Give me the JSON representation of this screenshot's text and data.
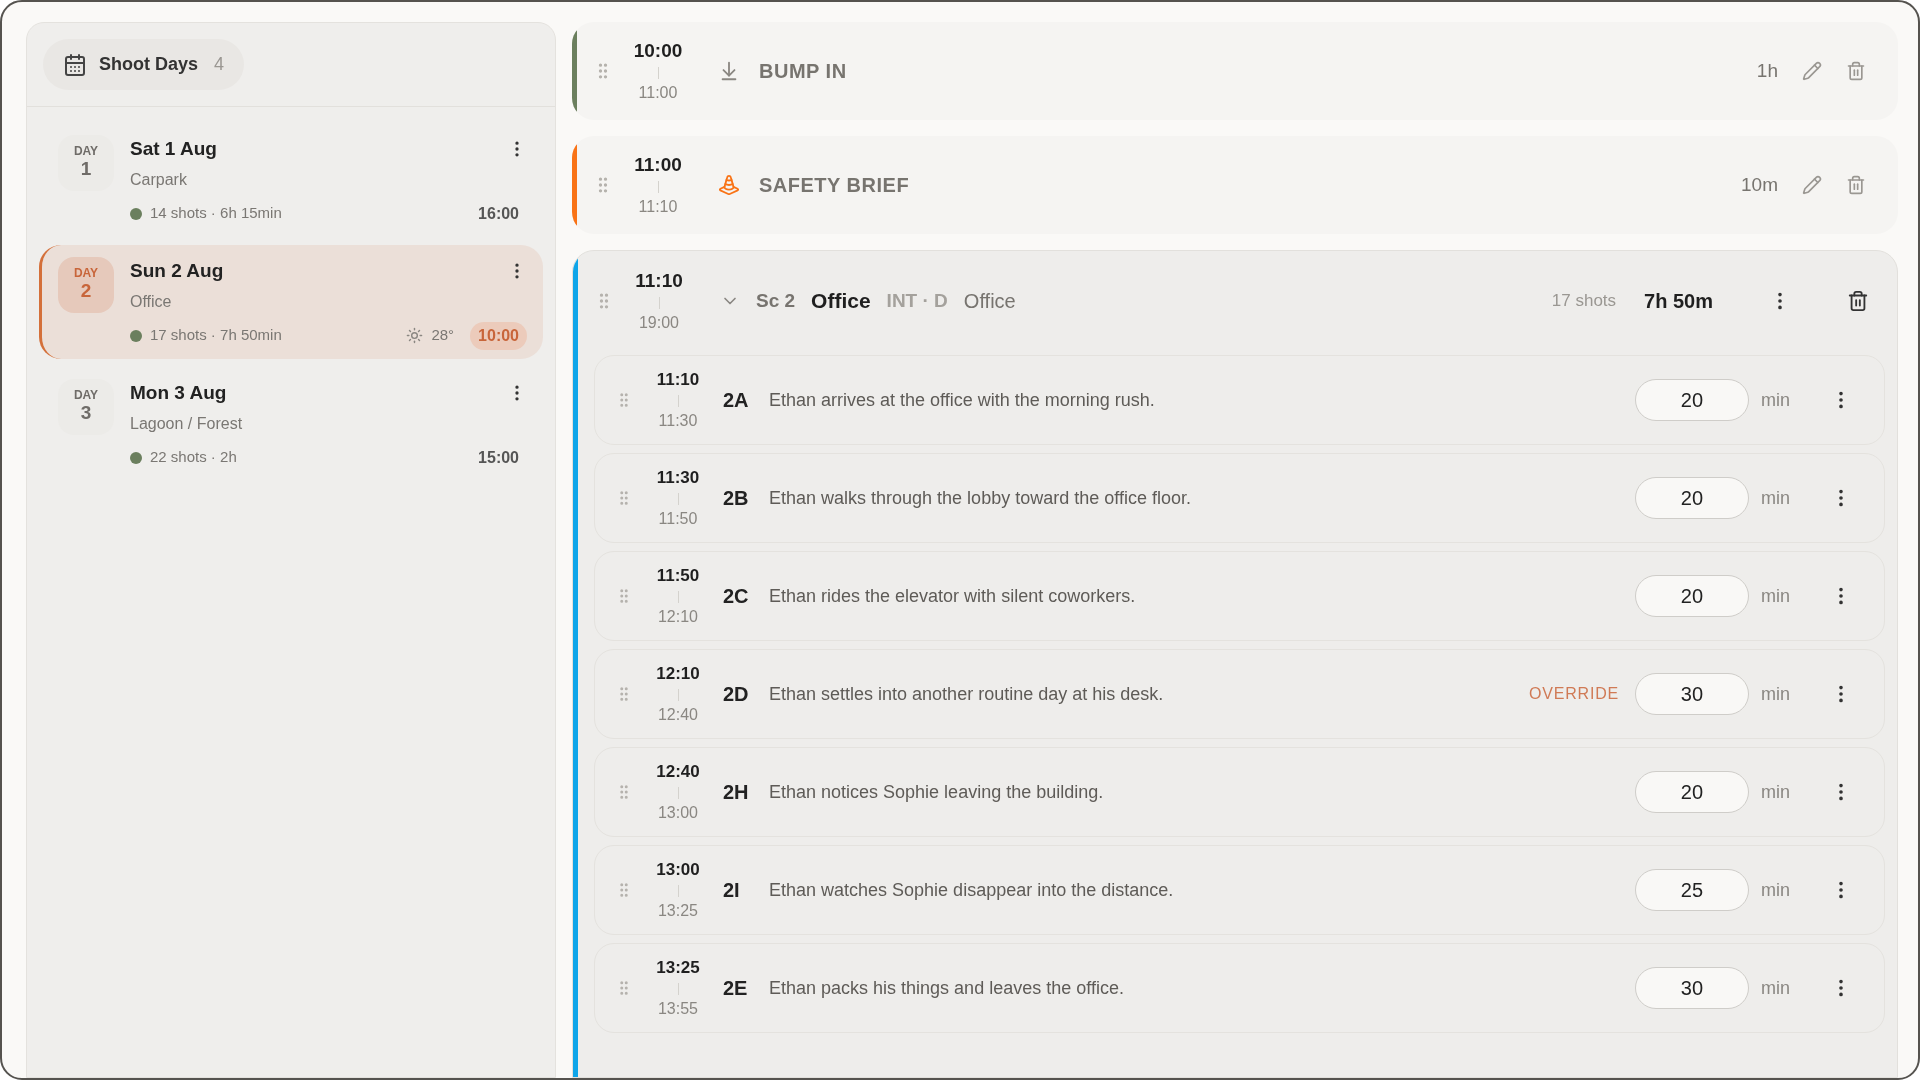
{
  "sidebar": {
    "title": "Shoot Days",
    "count": "4",
    "days": [
      {
        "label": "DAY",
        "number": "1",
        "date": "Sat 1 Aug",
        "location": "Carpark",
        "color": "#6b7f5e",
        "summary": "14 shots · 6h 15min",
        "call_time": "16:00",
        "selected": false
      },
      {
        "label": "DAY",
        "number": "2",
        "date": "Sun 2 Aug",
        "location": "Office",
        "color": "#6b7f5e",
        "summary": "17 shots · 7h 50min",
        "weather": "28°",
        "call_time": "10:00",
        "selected": true
      },
      {
        "label": "DAY",
        "number": "3",
        "date": "Mon 3 Aug",
        "location": "Lagoon / Forest",
        "color": "#6b7f5e",
        "summary": "22 shots · 2h",
        "call_time": "15:00",
        "selected": false
      }
    ]
  },
  "blocks": [
    {
      "kind": "load_in",
      "color": "#6b7f5e",
      "start": "10:00",
      "end": "11:00",
      "title": "BUMP IN",
      "duration": "1h"
    },
    {
      "kind": "safety",
      "color": "#f97316",
      "start": "11:00",
      "end": "11:10",
      "title": "SAFETY BRIEF",
      "duration": "10m"
    },
    {
      "kind": "scene",
      "color": "#0ea5e9",
      "start": "11:10",
      "end": "19:00",
      "expanded": true,
      "scene": "Sc 2",
      "name": "Office",
      "int_ext": "INT · D",
      "location": "Office",
      "shot_count": "17 shots",
      "duration": "7h 50m",
      "shots": [
        {
          "start": "11:10",
          "end": "11:30",
          "code": "2A",
          "description": "Ethan arrives at the office with the morning rush.",
          "minutes": "20",
          "unit": "min"
        },
        {
          "start": "11:30",
          "end": "11:50",
          "code": "2B",
          "description": "Ethan walks through the lobby toward the office floor.",
          "minutes": "20",
          "unit": "min"
        },
        {
          "start": "11:50",
          "end": "12:10",
          "code": "2C",
          "description": "Ethan rides the elevator with silent coworkers.",
          "minutes": "20",
          "unit": "min"
        },
        {
          "start": "12:10",
          "end": "12:40",
          "code": "2D",
          "description": "Ethan settles into another routine day at his desk.",
          "flag": "OVERRIDE",
          "minutes": "30",
          "unit": "min"
        },
        {
          "start": "12:40",
          "end": "13:00",
          "code": "2H",
          "description": "Ethan notices Sophie leaving the building.",
          "minutes": "20",
          "unit": "min"
        },
        {
          "start": "13:00",
          "end": "13:25",
          "code": "2I",
          "description": "Ethan watches Sophie disappear into the distance.",
          "minutes": "25",
          "unit": "min"
        },
        {
          "start": "13:25",
          "end": "13:55",
          "code": "2E",
          "description": "Ethan packs his things and leaves the office.",
          "minutes": "30",
          "unit": "min"
        }
      ]
    }
  ]
}
